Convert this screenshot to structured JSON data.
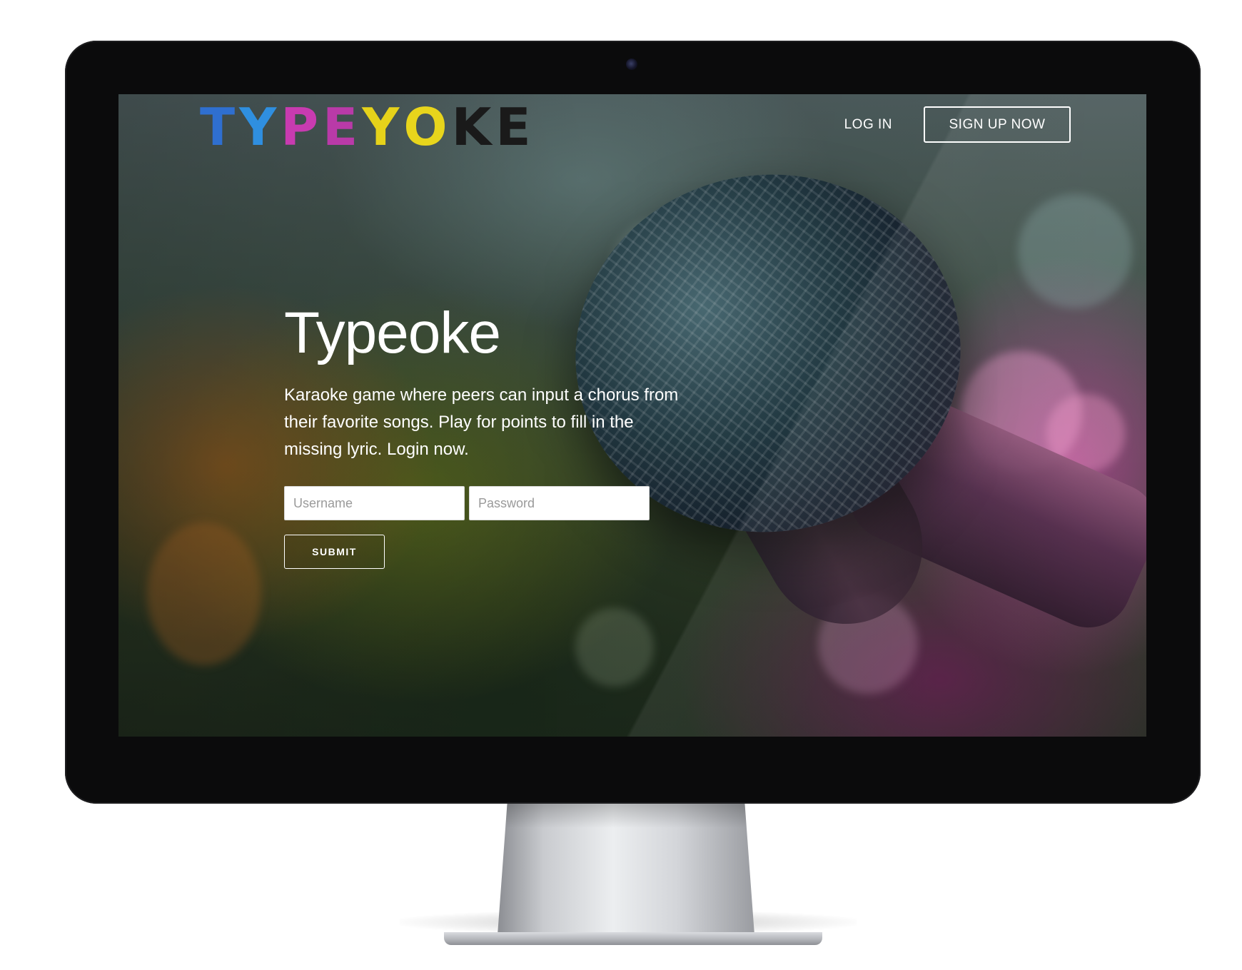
{
  "brand": {
    "letters": [
      {
        "char": "T",
        "color": "#2f6fd0"
      },
      {
        "char": "Y",
        "color": "#2f8fe0"
      },
      {
        "char": "P",
        "color": "#c83bb0"
      },
      {
        "char": "E",
        "color": "#b93aa8"
      },
      {
        "char": "Y",
        "color": "#e6d21a"
      },
      {
        "char": "O",
        "color": "#e8d51c"
      },
      {
        "char": "K",
        "color": "#1a1a1a"
      },
      {
        "char": "E",
        "color": "#1a1a1a"
      }
    ]
  },
  "nav": {
    "login_label": "LOG IN",
    "signup_label": "SIGN UP NOW"
  },
  "hero": {
    "title": "Typeoke",
    "description": "Karaoke game where peers can input a chorus from their favorite songs. Play for points to fill in the missing lyric. Login now."
  },
  "form": {
    "username_placeholder": "Username",
    "password_placeholder": "Password",
    "submit_label": "SUBMIT"
  },
  "colors": {
    "text": "#ffffff",
    "bezel": "#0b0b0c"
  }
}
